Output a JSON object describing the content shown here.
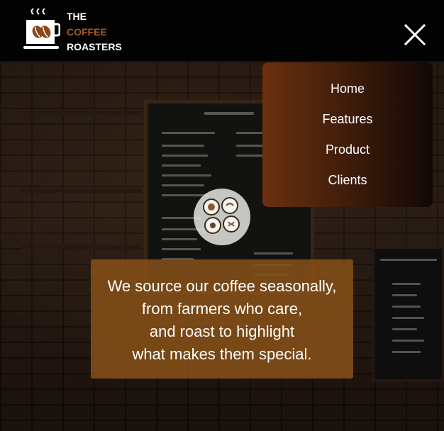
{
  "brand": {
    "line1": "THE",
    "line2": "COFFEE",
    "line3": "ROASTERS"
  },
  "header": {
    "close_icon": "close-x-icon"
  },
  "menu": {
    "items": [
      {
        "label": "Home"
      },
      {
        "label": "Features"
      },
      {
        "label": "Product"
      },
      {
        "label": "Clients"
      }
    ]
  },
  "hero": {
    "quote_lines": [
      "We source our coffee seasonally,",
      "from farmers who care,",
      "and roast to highlight",
      "what makes them special."
    ]
  },
  "colors": {
    "accent": "#a35a22",
    "quote_bg": "#87501a",
    "menu_from": "#6b300e",
    "menu_to": "#120806"
  }
}
